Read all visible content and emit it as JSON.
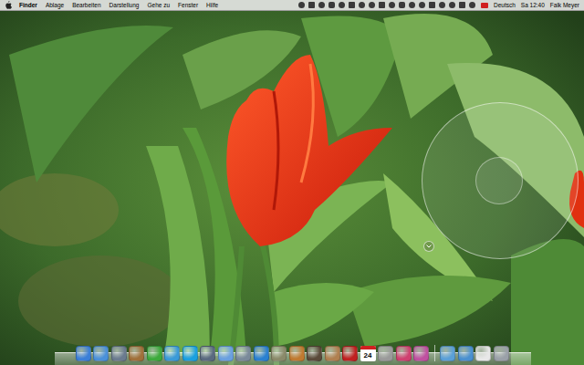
{
  "menu_bar": {
    "items": [
      {
        "label": "Finder",
        "bold": true
      },
      {
        "label": "Ablage",
        "bold": false
      },
      {
        "label": "Bearbeiten",
        "bold": false
      },
      {
        "label": "Darstellung",
        "bold": false
      },
      {
        "label": "Gehe zu",
        "bold": false
      },
      {
        "label": "Fenster",
        "bold": false
      },
      {
        "label": "Hilfe",
        "bold": false
      }
    ],
    "input_source": "Deutsch",
    "clock": "Sa 12:40",
    "user": "Falk Meyer"
  },
  "dock": {
    "calendar_day": "24"
  }
}
